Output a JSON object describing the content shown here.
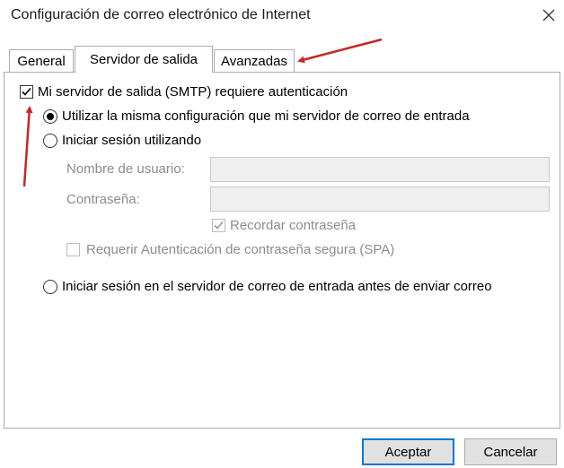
{
  "window": {
    "title": "Configuración de correo electrónico de Internet"
  },
  "tabs": [
    {
      "label": "General",
      "active": false
    },
    {
      "label": "Servidor de salida",
      "active": true
    },
    {
      "label": "Avanzadas",
      "active": false
    }
  ],
  "outgoing": {
    "smtp_auth_label": "Mi servidor de salida (SMTP) requiere autenticación",
    "smtp_auth_checked": true,
    "use_same_label": "Utilizar la misma configuración que mi servidor de correo de entrada",
    "login_using_label": "Iniciar sesión utilizando",
    "username_label": "Nombre de usuario:",
    "username_value": "",
    "password_label": "Contraseña:",
    "password_value": "",
    "remember_label": "Recordar contraseña",
    "spa_label": "Requerir Autenticación de contraseña segura (SPA)",
    "login_before_label": "Iniciar sesión en el servidor de correo de entrada antes de enviar correo"
  },
  "buttons": {
    "accept": "Aceptar",
    "cancel": "Cancelar"
  },
  "colors": {
    "annotation_arrow": "#c62828",
    "default_button_border": "#0078d7"
  }
}
